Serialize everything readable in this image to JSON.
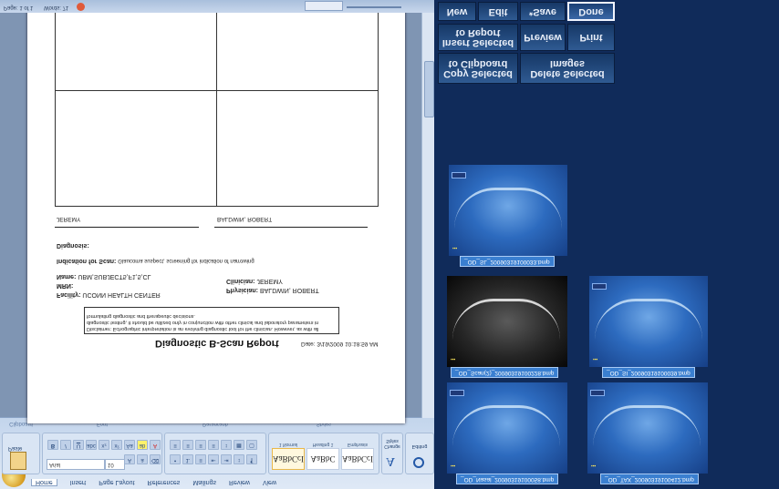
{
  "word": {
    "status": {
      "page": "Page: 1 of 1",
      "words": "Words: 71"
    },
    "tabs": [
      "Home",
      "Insert",
      "Page Layout",
      "References",
      "Mailings",
      "Review",
      "View"
    ],
    "groups": {
      "clipboard": "Clipboard",
      "font": "Font",
      "paragraph": "Paragraph",
      "styles": "Styles",
      "editing": "Editing"
    },
    "paste": "Paste",
    "font_name": "Arial",
    "font_size": "10",
    "styles": [
      {
        "preview": "AaBbCcI",
        "name": "1 Normal"
      },
      {
        "preview": "AaBbC",
        "name": "Heading 1"
      },
      {
        "preview": "AaBbCcI",
        "name": "Emphasis"
      }
    ],
    "change_styles": "Change Styles",
    "editing": "Editing"
  },
  "report": {
    "title": "Diagnostic B-Scan Report",
    "date": "Date: 3/19/2009 10:18:59 AM",
    "disclaimer": "Disclaimer: Echographic interpretation is an evolving diagnostic tool for the clinician. However, as with all diagnostic testing, it should be utilized only in conjunction with other clinical and laboratory parameters in formulating diagnostic and therapeutic decisions.",
    "facility_label": "Facility:",
    "facility": "UCONN HEALTH CENTER",
    "mrn_label": "MRN:",
    "physician_label": "Physician:",
    "physician": "BALDWIN, ROBERT",
    "name_label": "Name:",
    "name": "UBM,SUBJECT5,F1,5,CL",
    "clinician_label": "Clinician:",
    "clinician": "JEREMY",
    "indication_label": "Indication for Scan:",
    "indication": "Glaucoma suspect, screening for indication of narrowing",
    "diagnosis_label": "Diagnosis:",
    "sig_left": "JEREMY",
    "sig_right": "BALDWIN, ROBERT"
  },
  "viewer": {
    "buttons": {
      "new": "New",
      "edit": "Edit",
      "save": "*Save",
      "done": "Done",
      "insert_selected": "Insert Selected to Report",
      "preview": "Preview",
      "print": "Print",
      "copy_selected": "Copy Selected to Clipboard",
      "delete_selected": "Delete Selected Images"
    },
    "images": [
      {
        "caption": "_OD_SL_20090319100033.bmp",
        "style": "blue"
      },
      {
        "caption": "_OD_Scan(2)_20090319100228.bmp",
        "style": "bw"
      },
      {
        "caption": "_OD_SI_20090319100039.bmp",
        "style": "blue"
      },
      {
        "caption": "_OD_Nasal_20090319100058.bmp",
        "style": "blue"
      },
      {
        "caption": "_OD_TAX_20090319100412.bmp",
        "style": "blue"
      }
    ]
  }
}
